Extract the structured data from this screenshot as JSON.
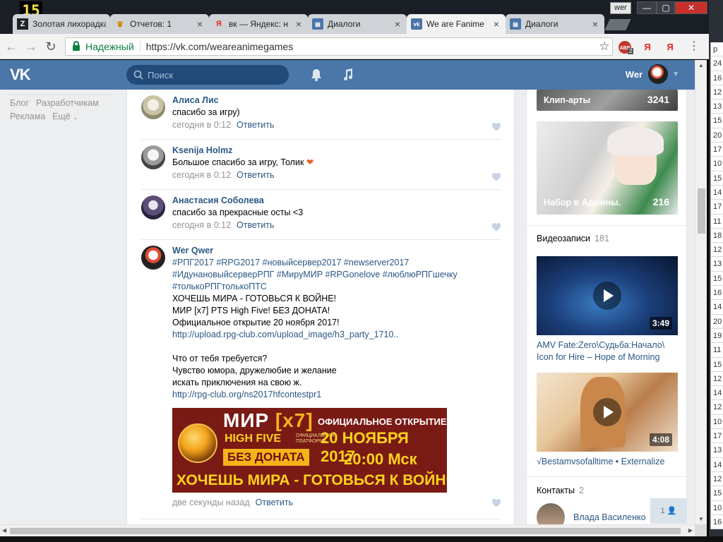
{
  "window": {
    "counter": "15",
    "user_label": "wer",
    "minimize": "—",
    "maximize": "▢",
    "close": "✕"
  },
  "tabs": [
    {
      "title": "Золотая лихорадка",
      "icon": "Z"
    },
    {
      "title": "Отчетов: 1",
      "icon": "♛"
    },
    {
      "title": "вк — Яндекс: н",
      "icon": "Я"
    },
    {
      "title": "Диалоги",
      "icon": "vk"
    },
    {
      "title": "We are Fanime",
      "icon": "vk"
    },
    {
      "title": "Диалоги",
      "icon": "vk"
    }
  ],
  "toolbar": {
    "back": "←",
    "forward": "→",
    "reload": "↻",
    "secure_label": "Надежный",
    "url": "https://vk.com/weareanimegames",
    "star": "☆",
    "abp": "ABP",
    "abp_badge": "2",
    "ya": "Я",
    "menu": "⋮"
  },
  "vk": {
    "logo": "VK",
    "search_placeholder": "Поиск",
    "username": "Wer",
    "left_links": [
      "Блог",
      "Разработчикам",
      "Реклама",
      "Ещё"
    ]
  },
  "comments": [
    {
      "author": "Алиса Лис",
      "text": "спасибо за игру)",
      "time": "сегодня в 0:12",
      "reply": "Ответить"
    },
    {
      "author": "Ksenija Holmz",
      "text": "Большое спасибо за игру, Толик",
      "time": "сегодня в 0:12",
      "reply": "Ответить"
    },
    {
      "author": "Анастасия Соболева",
      "text": "спасибо за прекрасные осты <3",
      "time": "сегодня в 0:12",
      "reply": "Ответить"
    },
    {
      "author": "Wer Qwer",
      "tags_line1": "#РПГ2017 #RPG2017 #новыйсервер2017 #newserver2017",
      "tags_line2": "#ИдунановыйсерверРПГ #МируМИР #RPGonelove #люблюРПГшечку",
      "tags_line3": "#толькоРПГтолькоПТС",
      "line1": "ХОЧЕШЬ МИРА - ГОТОВЬСЯ К ВОЙНЕ!",
      "line2": "МИР [x7] PTS High Five! БЕЗ ДОНАТА!",
      "line3": "Официальное открытие 20 ноября 2017!",
      "link1": "http://upload.rpg-club.com/upload_image/h3_party_1710..",
      "line4": "Что от тебя требуется?",
      "line5": "Чувство юмора, дружелюбие и желание",
      "line6": "искать приключения на свою ж.",
      "link2": "http://rpg-club.org/ns2017hfcontestpr1",
      "time": "две секунды назад",
      "reply": "Ответить"
    }
  ],
  "banner": {
    "mir": "МИР",
    "x7": "[x7]",
    "high_five": "HIGH FIVE",
    "platform": "ОФИЦИАЛЬНАЯ ПЛАТФОРМА",
    "no_donate": "БЕЗ ДОНАТА",
    "opening": "ОФИЦИАЛЬНОЕ ОТКРЫТИЕ",
    "date": "20 НОЯБРЯ 2017",
    "time": "20:00 Мск",
    "slogan": "ХОЧЕШЬ МИРА - ГОТОВЬСЯ К ВОЙНЕ"
  },
  "sidebar": {
    "albums": [
      {
        "title": "Клип-арты",
        "count": "3241"
      },
      {
        "title": "Набор в Админы.",
        "count": "216"
      }
    ],
    "videos_title": "Видеозаписи",
    "videos_count": "181",
    "videos": [
      {
        "title": "AMV Fate:Zero\\Судьба:Начало\\ Icon for Hire – Hope of Morning",
        "duration": "3:49"
      },
      {
        "title": "√Bestamvsofalltime • Externalize",
        "duration": "4:08"
      }
    ],
    "contacts_title": "Контакты",
    "contacts_count": "2",
    "contact_name": "Влада Василенко",
    "float_count": "1"
  },
  "sheet_rows": [
    "р",
    "24",
    "16",
    "12",
    "13",
    "15",
    "20",
    "17",
    "10",
    "15",
    "14",
    "17",
    "11",
    "18",
    "12",
    "13",
    "15",
    "16",
    "14",
    "20",
    "19",
    "11",
    "15",
    "12",
    "14",
    "12",
    "10",
    "17",
    "13",
    "14",
    "12",
    "15",
    "10",
    "16"
  ]
}
